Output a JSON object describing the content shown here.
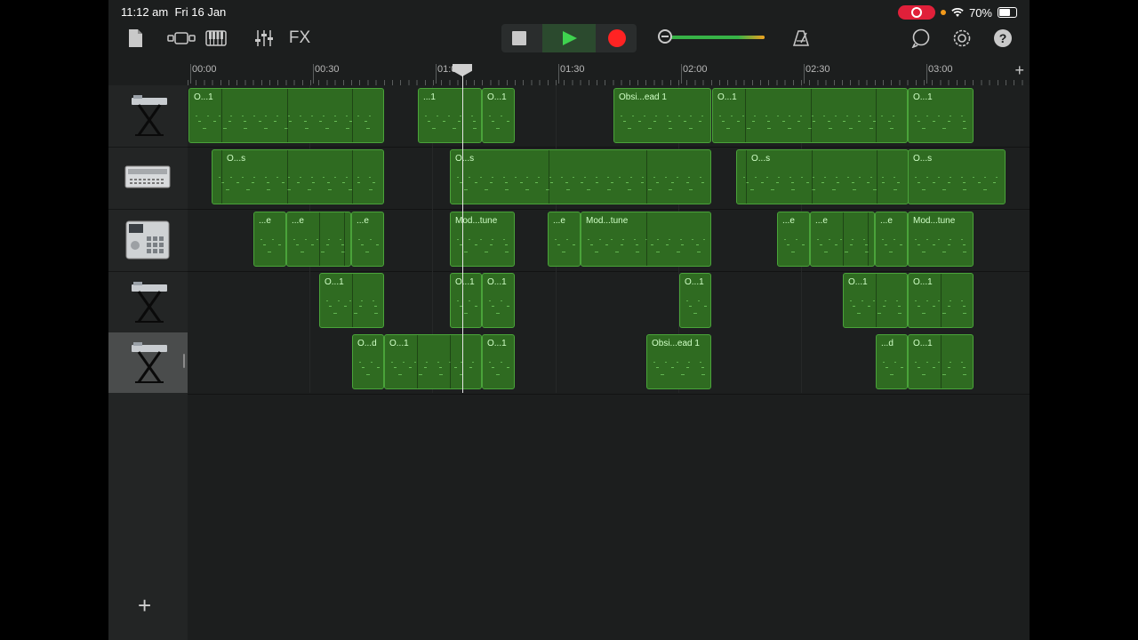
{
  "status_bar": {
    "time": "11:12 am",
    "date": "Fri 16 Jan",
    "battery": "70%",
    "battery_level": 0.7
  },
  "toolbar": {
    "icons": [
      "document-icon",
      "view-toggle-icon",
      "keyboard-icon",
      "mixer-icon"
    ],
    "fx_label": "FX",
    "right_icons": [
      "loop-icon",
      "settings-icon",
      "help-icon"
    ]
  },
  "master_volume": 0.98,
  "ruler": {
    "labels": [
      "00:00",
      "00:30",
      "01:00",
      "01:30",
      "02:00",
      "02:30",
      "03:00"
    ]
  },
  "tracks": [
    {
      "instrument": "keyboard-stand-icon",
      "regions": [
        "O...1",
        "...1",
        "O...1",
        "Obsi...ead 1",
        "O...1",
        "O...1"
      ]
    },
    {
      "instrument": "synth-module-icon",
      "regions": [
        "O...s",
        "O...s",
        "O...s",
        "O...s"
      ]
    },
    {
      "instrument": "drum-machine-icon",
      "regions": [
        "...e",
        "...e",
        "...e",
        "Mod...tune",
        "...e",
        "Mod...tune",
        "...e",
        "...e",
        "...e",
        "Mod...tune"
      ]
    },
    {
      "instrument": "keyboard-stand-icon",
      "regions": [
        "O...1",
        "O...1",
        "O...1",
        "O...1",
        "O...1",
        "O...1"
      ]
    },
    {
      "instrument": "keyboard-stand-icon",
      "selected": true,
      "regions": [
        "O...d",
        "O...1",
        "O...1",
        "Obsi...ead 1",
        "...d",
        "O...1"
      ]
    }
  ],
  "playhead_time": "01:03",
  "add_track_label": "+"
}
